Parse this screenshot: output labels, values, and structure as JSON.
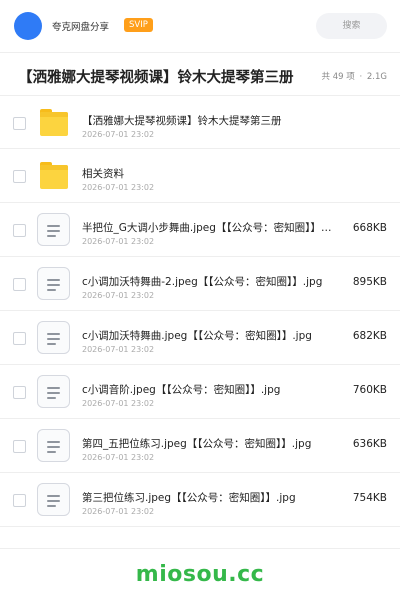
{
  "header": {
    "share_title": "夸克网盘分享",
    "badge": "SVIP",
    "search_placeholder": "搜索"
  },
  "folder": {
    "title": "【洒雅娜大提琴视频课】铃木大提琴第三册",
    "item_count": "共 49 项",
    "separator": "·",
    "total_size": "2.1G"
  },
  "items": [
    {
      "type": "folder",
      "name": "【洒雅娜大提琴视频课】铃木大提琴第三册",
      "date": "2026-07-01 23:02",
      "size": ""
    },
    {
      "type": "folder",
      "name": "相关资料",
      "date": "2026-07-01 23:02",
      "size": ""
    },
    {
      "type": "file",
      "name": "半把位_G大调小步舞曲.jpeg【【公众号：密知圈】】.jpg",
      "date": "2026-07-01 23:02",
      "size": "668KB"
    },
    {
      "type": "file",
      "name": "c小调加沃特舞曲-2.jpeg【【公众号：密知圈】】.jpg",
      "date": "2026-07-01 23:02",
      "size": "895KB"
    },
    {
      "type": "file",
      "name": "c小调加沃特舞曲.jpeg【【公众号：密知圈】】.jpg",
      "date": "2026-07-01 23:02",
      "size": "682KB"
    },
    {
      "type": "file",
      "name": "c小调音阶.jpeg【【公众号：密知圈】】.jpg",
      "date": "2026-07-01 23:02",
      "size": "760KB"
    },
    {
      "type": "file",
      "name": "第四_五把位练习.jpeg【【公众号：密知圈】】.jpg",
      "date": "2026-07-01 23:02",
      "size": "636KB"
    },
    {
      "type": "file",
      "name": "第三把位练习.jpeg【【公众号：密知圈】】.jpg",
      "date": "2026-07-01 23:02",
      "size": "754KB"
    }
  ],
  "footer": {
    "watermark": "miosou.cc"
  },
  "colors": {
    "accent": "#2f7bf6",
    "svip": "#ff9f1a",
    "folder": "#fcd43f",
    "watermark": "#35b84a"
  },
  "icons": {
    "avatar": "avatar-circle",
    "folder": "folder-icon",
    "file": "document-icon",
    "checkbox": "checkbox-icon"
  }
}
